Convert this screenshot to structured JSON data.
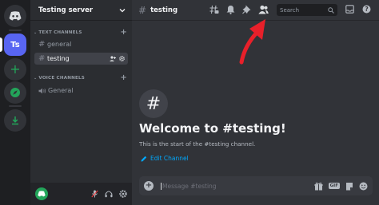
{
  "server_rail": {
    "active_server_initials": "Ts"
  },
  "sidebar": {
    "server_name": "Testing server",
    "text_category": "TEXT CHANNELS",
    "voice_category": "VOICE CHANNELS",
    "text_channels": [
      {
        "name": "general"
      },
      {
        "name": "testing"
      }
    ],
    "voice_channels": [
      {
        "name": "General"
      }
    ]
  },
  "topbar": {
    "channel_name": "testing",
    "search_placeholder": "Search"
  },
  "welcome": {
    "title": "Welcome to #testing!",
    "subtitle": "This is the start of the #testing channel.",
    "edit_label": "Edit Channel"
  },
  "composer": {
    "placeholder": "Message #testing",
    "gif_label": "GIF"
  },
  "colors": {
    "accent": "#5865f2",
    "annotation_arrow": "#e8202a"
  }
}
